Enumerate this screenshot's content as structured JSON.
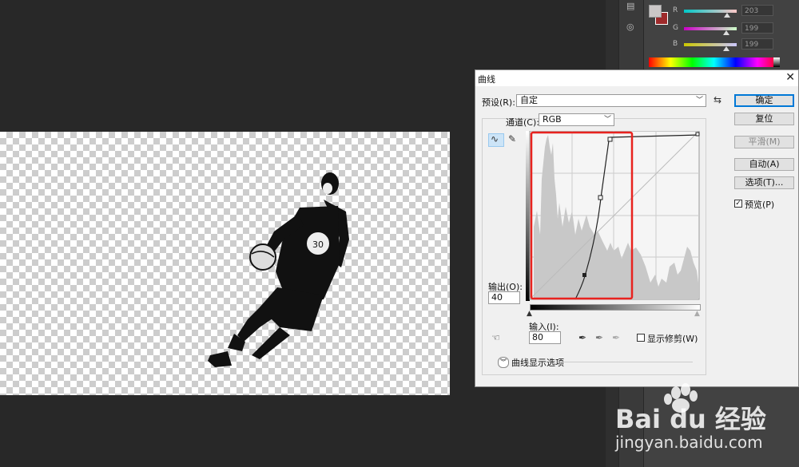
{
  "color_panel": {
    "rgb": [
      {
        "label": "R",
        "value": "203",
        "color": "#cb0000"
      },
      {
        "label": "G",
        "value": "199",
        "color": "#00c700"
      },
      {
        "label": "B",
        "value": "199",
        "color": "#0000c7"
      }
    ],
    "foreground_color": "#cbc7c7",
    "background_color": "#9e2a2b"
  },
  "dialog": {
    "title": "曲线",
    "preset_label": "预设(R):",
    "preset_value": "自定",
    "channel_label": "通道(C):",
    "channel_value": "RGB",
    "output_label": "输出(O):",
    "output_value": "40",
    "input_label": "输入(I):",
    "input_value": "80",
    "show_clipping_label": "显示修剪(W)",
    "show_clipping_checked": false,
    "curve_display_options": "曲线显示选项",
    "buttons": {
      "ok": "确定",
      "reset": "复位",
      "smooth": "平滑(M)",
      "auto": "自动(A)",
      "options": "选项(T)..."
    },
    "preview_label": "预览(P)",
    "preview_checked": true,
    "highlight_color": "#e8231f"
  },
  "watermark": {
    "brand": "Bai du 经验",
    "url": "jingyan.baidu.com"
  }
}
